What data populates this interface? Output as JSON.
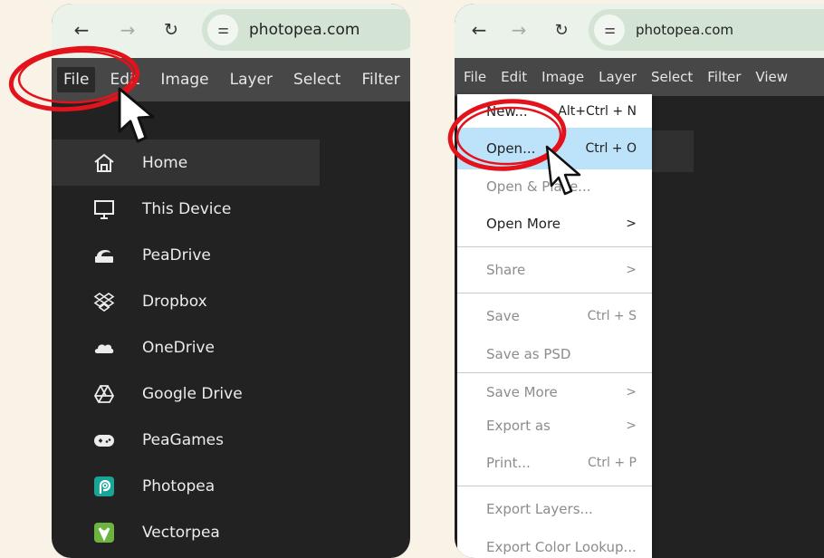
{
  "browser": {
    "url": "photopea.com"
  },
  "menubar": {
    "items": [
      "File",
      "Edit",
      "Image",
      "Layer",
      "Select",
      "Filter",
      "View"
    ]
  },
  "home_sidebar": {
    "items": [
      {
        "label": "Home",
        "icon": "home-icon"
      },
      {
        "label": "This Device",
        "icon": "monitor-icon"
      },
      {
        "label": "PeaDrive",
        "icon": "peadrive-icon"
      },
      {
        "label": "Dropbox",
        "icon": "dropbox-icon"
      },
      {
        "label": "OneDrive",
        "icon": "onedrive-icon"
      },
      {
        "label": "Google Drive",
        "icon": "google-drive-icon"
      },
      {
        "label": "PeaGames",
        "icon": "gamepad-icon"
      },
      {
        "label": "Photopea",
        "icon": "photopea-icon"
      },
      {
        "label": "Vectorpea",
        "icon": "vectorpea-icon"
      }
    ]
  },
  "file_menu": {
    "new": {
      "label": "New...",
      "shortcut": "Alt+Ctrl + N"
    },
    "open": {
      "label": "Open...",
      "shortcut": "Ctrl + O"
    },
    "open_place": {
      "label": "Open & Place..."
    },
    "open_more": {
      "label": "Open More",
      "arrow": ">"
    },
    "share": {
      "label": "Share",
      "arrow": ">"
    },
    "save": {
      "label": "Save",
      "shortcut": "Ctrl + S"
    },
    "save_psd": {
      "label": "Save as PSD"
    },
    "save_more": {
      "label": "Save More",
      "arrow": ">"
    },
    "export_as": {
      "label": "Export as",
      "arrow": ">"
    },
    "print": {
      "label": "Print...",
      "shortcut": "Ctrl + P"
    },
    "export_layers": {
      "label": "Export Layers..."
    },
    "export_lut": {
      "label": "Export Color Lookup..."
    }
  },
  "colors": {
    "annotation_red": "#e3121b",
    "menu_highlight": "#bde3fa",
    "app_bg": "#222222",
    "page_bg": "#f8f2e7"
  }
}
